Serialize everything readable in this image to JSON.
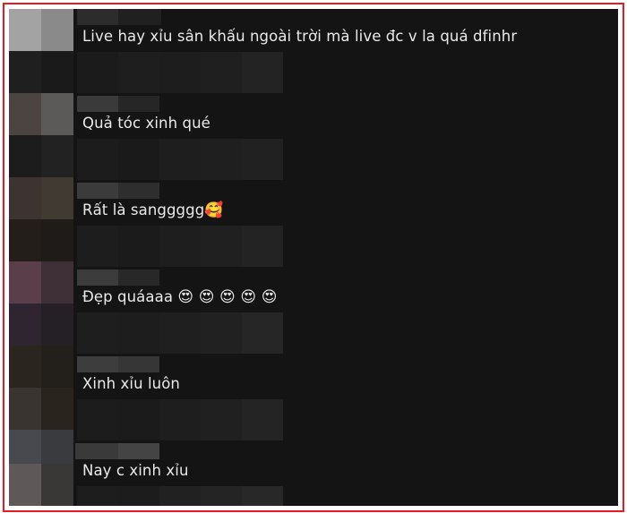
{
  "comments": [
    {
      "text": "Live hay xỉu sân khấu ngoài trời mà live đc v la quá dfinhr",
      "emoji": ""
    },
    {
      "text": "Quả tóc xinh qué",
      "emoji": ""
    },
    {
      "text": "Rất là sanggggg",
      "emoji": "🥰"
    },
    {
      "text": "Đẹp quáaaa ",
      "emoji": "😍 😍 😍 😍 😍"
    },
    {
      "text": "Xinh xỉu luôn",
      "emoji": ""
    },
    {
      "text": "Nay c xinh xỉu",
      "emoji": ""
    }
  ],
  "colors": {
    "frame_border": "#e31b23",
    "background": "#141414",
    "text": "#eaeaea"
  }
}
